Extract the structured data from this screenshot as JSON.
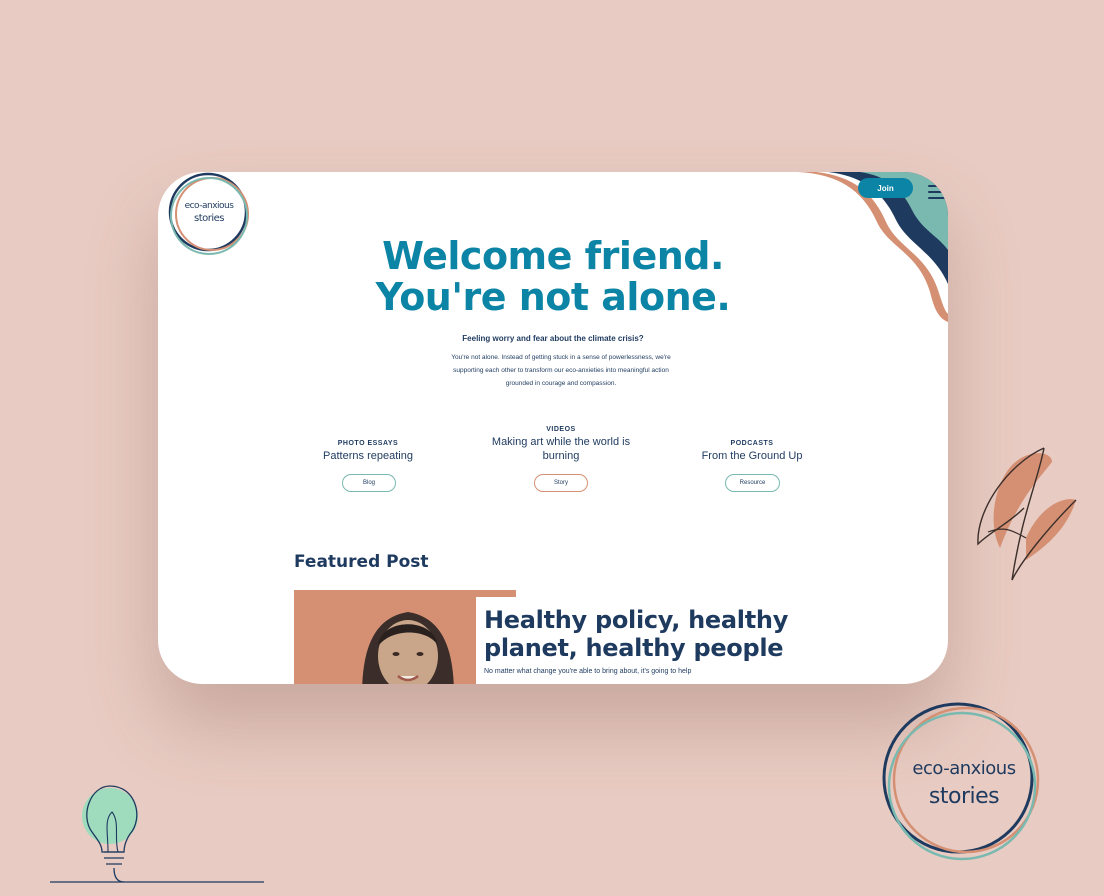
{
  "brand": {
    "name_line1": "eco-anxious",
    "name_line2": "stories"
  },
  "colors": {
    "teal": "#0b84a5",
    "navy": "#1e3a5f",
    "coral": "#d59073",
    "mint": "#79b9b0",
    "background": "#e8cbc2"
  },
  "header": {
    "join_label": "Join",
    "menu_icon": "hamburger-menu-icon"
  },
  "hero": {
    "title_line1": "Welcome friend.",
    "title_line2": "You're not alone.",
    "subtitle": "Feeling worry and fear about the climate crisis?",
    "body_line1": "You're not alone. Instead of getting stuck in a sense of powerlessness, we're",
    "body_line2": "supporting each other to transform our eco-anxieties into meaningful action",
    "body_line3": "grounded in courage and compassion."
  },
  "categories": [
    {
      "label": "PHOTO ESSAYS",
      "title_line1": "Patterns repeating",
      "title_line2": "",
      "button": "Blog"
    },
    {
      "label": "VIDEOS",
      "title_line1": "Making art while the world is",
      "title_line2": "burning",
      "button": "Story"
    },
    {
      "label": "PODCASTS",
      "title_line1": "From the Ground Up",
      "title_line2": "",
      "button": "Resource"
    }
  ],
  "featured": {
    "heading": "Featured Post",
    "title_line1": "Healthy policy, healthy",
    "title_line2": "planet, healthy people",
    "excerpt": "No matter what change you're able to bring about, it's going to help"
  }
}
